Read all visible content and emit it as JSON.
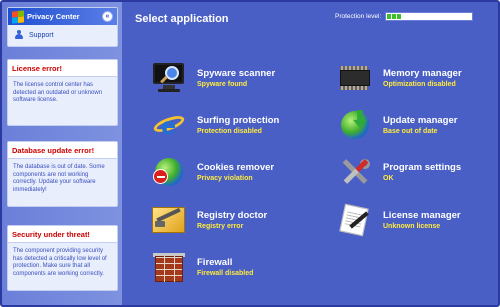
{
  "sidebar": {
    "header": {
      "title": "Privacy Center",
      "link": "Support"
    },
    "warnings": [
      {
        "title": "License error!",
        "text": "The license control center has detected an outdated or unknown software license."
      },
      {
        "title": "Database update error!",
        "text": "The database is out of date. Some components are not working correctly. Update your software immediately!"
      },
      {
        "title": "Security under threat!",
        "text": "The component providing security has detected a critically low level of protection. Make sure that all components are working correctly."
      }
    ]
  },
  "main": {
    "title": "Select application",
    "protection": {
      "label": "Protection level:",
      "level_fraction": 0.12
    },
    "items": [
      {
        "name": "Spyware scanner",
        "status": "Spyware found",
        "icon": "monitor-scan-icon"
      },
      {
        "name": "Surfing protection",
        "status": "Protection disabled",
        "icon": "internet-explorer-icon"
      },
      {
        "name": "Cookies remover",
        "status": "Privacy violation",
        "icon": "globe-block-icon"
      },
      {
        "name": "Registry doctor",
        "status": "Registry error",
        "icon": "registry-tool-icon"
      },
      {
        "name": "Firewall",
        "status": "Firewall disabled",
        "icon": "brick-wall-icon"
      },
      {
        "name": "Memory manager",
        "status": "Optimization disabled",
        "icon": "memory-chip-icon"
      },
      {
        "name": "Update manager",
        "status": "Base out of date",
        "icon": "globe-download-icon"
      },
      {
        "name": "Program settings",
        "status": "OK",
        "icon": "tools-icon"
      },
      {
        "name": "License manager",
        "status": "Unknown license",
        "icon": "license-document-icon"
      }
    ]
  },
  "colors": {
    "background": "#4a5fc6",
    "status_text": "#ffeb3b",
    "error_title": "#cc0000",
    "meter_fill": "#3bbf2b"
  }
}
